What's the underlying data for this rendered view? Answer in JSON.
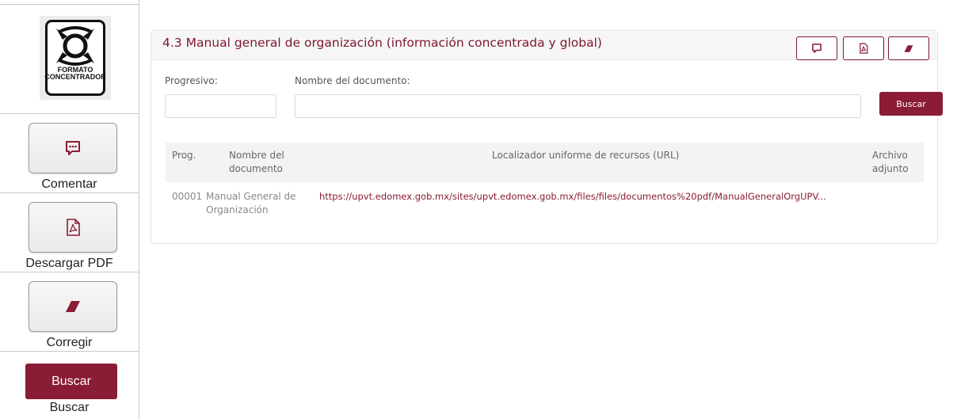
{
  "sidebar": {
    "logo": {
      "line1": "FORMATO",
      "line2": "CONCENTRADOR"
    },
    "comment": {
      "label": "Comentar",
      "icon": "comment-icon"
    },
    "pdf": {
      "label": "Descargar PDF",
      "icon": "pdf-icon"
    },
    "correct": {
      "label": "Corregir",
      "icon": "eraser-icon"
    },
    "search": {
      "button": "Buscar",
      "label": "Buscar"
    }
  },
  "panel": {
    "title": "4.3 Manual general de organización (información concentrada y global)",
    "header_buttons": [
      "comment-icon",
      "pdf-icon",
      "eraser-icon"
    ]
  },
  "form": {
    "progresivo_label": "Progresivo:",
    "progresivo_value": "",
    "nombre_label": "Nombre del documento:",
    "nombre_value": "",
    "search_button": "Buscar"
  },
  "table": {
    "headers": {
      "prog": "Prog.",
      "nombre_1": "Nombre del",
      "nombre_2": "documento",
      "url": "Localizador uniforme de recursos (URL)",
      "archivo_1": "Archivo",
      "archivo_2": "adjunto"
    },
    "rows": [
      {
        "prog": "00001",
        "nombre_1": "Manual General de",
        "nombre_2": "Organización",
        "url": "https://upvt.edomex.gob.mx/sites/upvt.edomex.gob.mx/files/files/documentos%20pdf/ManualGeneralOrgUPV...",
        "archivo": ""
      }
    ]
  },
  "colors": {
    "accent": "#8a1c35",
    "title": "#7d1730"
  }
}
